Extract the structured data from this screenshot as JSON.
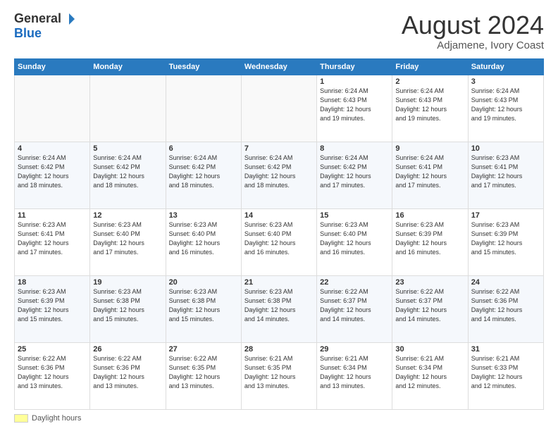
{
  "logo": {
    "general": "General",
    "blue": "Blue"
  },
  "header": {
    "month_year": "August 2024",
    "location": "Adjamene, Ivory Coast"
  },
  "days_of_week": [
    "Sunday",
    "Monday",
    "Tuesday",
    "Wednesday",
    "Thursday",
    "Friday",
    "Saturday"
  ],
  "footer": {
    "swatch_label": "Daylight hours"
  },
  "weeks": [
    [
      {
        "day": "",
        "info": ""
      },
      {
        "day": "",
        "info": ""
      },
      {
        "day": "",
        "info": ""
      },
      {
        "day": "",
        "info": ""
      },
      {
        "day": "1",
        "info": "Sunrise: 6:24 AM\nSunset: 6:43 PM\nDaylight: 12 hours\nand 19 minutes."
      },
      {
        "day": "2",
        "info": "Sunrise: 6:24 AM\nSunset: 6:43 PM\nDaylight: 12 hours\nand 19 minutes."
      },
      {
        "day": "3",
        "info": "Sunrise: 6:24 AM\nSunset: 6:43 PM\nDaylight: 12 hours\nand 19 minutes."
      }
    ],
    [
      {
        "day": "4",
        "info": "Sunrise: 6:24 AM\nSunset: 6:42 PM\nDaylight: 12 hours\nand 18 minutes."
      },
      {
        "day": "5",
        "info": "Sunrise: 6:24 AM\nSunset: 6:42 PM\nDaylight: 12 hours\nand 18 minutes."
      },
      {
        "day": "6",
        "info": "Sunrise: 6:24 AM\nSunset: 6:42 PM\nDaylight: 12 hours\nand 18 minutes."
      },
      {
        "day": "7",
        "info": "Sunrise: 6:24 AM\nSunset: 6:42 PM\nDaylight: 12 hours\nand 18 minutes."
      },
      {
        "day": "8",
        "info": "Sunrise: 6:24 AM\nSunset: 6:42 PM\nDaylight: 12 hours\nand 17 minutes."
      },
      {
        "day": "9",
        "info": "Sunrise: 6:24 AM\nSunset: 6:41 PM\nDaylight: 12 hours\nand 17 minutes."
      },
      {
        "day": "10",
        "info": "Sunrise: 6:23 AM\nSunset: 6:41 PM\nDaylight: 12 hours\nand 17 minutes."
      }
    ],
    [
      {
        "day": "11",
        "info": "Sunrise: 6:23 AM\nSunset: 6:41 PM\nDaylight: 12 hours\nand 17 minutes."
      },
      {
        "day": "12",
        "info": "Sunrise: 6:23 AM\nSunset: 6:40 PM\nDaylight: 12 hours\nand 17 minutes."
      },
      {
        "day": "13",
        "info": "Sunrise: 6:23 AM\nSunset: 6:40 PM\nDaylight: 12 hours\nand 16 minutes."
      },
      {
        "day": "14",
        "info": "Sunrise: 6:23 AM\nSunset: 6:40 PM\nDaylight: 12 hours\nand 16 minutes."
      },
      {
        "day": "15",
        "info": "Sunrise: 6:23 AM\nSunset: 6:40 PM\nDaylight: 12 hours\nand 16 minutes."
      },
      {
        "day": "16",
        "info": "Sunrise: 6:23 AM\nSunset: 6:39 PM\nDaylight: 12 hours\nand 16 minutes."
      },
      {
        "day": "17",
        "info": "Sunrise: 6:23 AM\nSunset: 6:39 PM\nDaylight: 12 hours\nand 15 minutes."
      }
    ],
    [
      {
        "day": "18",
        "info": "Sunrise: 6:23 AM\nSunset: 6:39 PM\nDaylight: 12 hours\nand 15 minutes."
      },
      {
        "day": "19",
        "info": "Sunrise: 6:23 AM\nSunset: 6:38 PM\nDaylight: 12 hours\nand 15 minutes."
      },
      {
        "day": "20",
        "info": "Sunrise: 6:23 AM\nSunset: 6:38 PM\nDaylight: 12 hours\nand 15 minutes."
      },
      {
        "day": "21",
        "info": "Sunrise: 6:23 AM\nSunset: 6:38 PM\nDaylight: 12 hours\nand 14 minutes."
      },
      {
        "day": "22",
        "info": "Sunrise: 6:22 AM\nSunset: 6:37 PM\nDaylight: 12 hours\nand 14 minutes."
      },
      {
        "day": "23",
        "info": "Sunrise: 6:22 AM\nSunset: 6:37 PM\nDaylight: 12 hours\nand 14 minutes."
      },
      {
        "day": "24",
        "info": "Sunrise: 6:22 AM\nSunset: 6:36 PM\nDaylight: 12 hours\nand 14 minutes."
      }
    ],
    [
      {
        "day": "25",
        "info": "Sunrise: 6:22 AM\nSunset: 6:36 PM\nDaylight: 12 hours\nand 13 minutes."
      },
      {
        "day": "26",
        "info": "Sunrise: 6:22 AM\nSunset: 6:36 PM\nDaylight: 12 hours\nand 13 minutes."
      },
      {
        "day": "27",
        "info": "Sunrise: 6:22 AM\nSunset: 6:35 PM\nDaylight: 12 hours\nand 13 minutes."
      },
      {
        "day": "28",
        "info": "Sunrise: 6:21 AM\nSunset: 6:35 PM\nDaylight: 12 hours\nand 13 minutes."
      },
      {
        "day": "29",
        "info": "Sunrise: 6:21 AM\nSunset: 6:34 PM\nDaylight: 12 hours\nand 13 minutes."
      },
      {
        "day": "30",
        "info": "Sunrise: 6:21 AM\nSunset: 6:34 PM\nDaylight: 12 hours\nand 12 minutes."
      },
      {
        "day": "31",
        "info": "Sunrise: 6:21 AM\nSunset: 6:33 PM\nDaylight: 12 hours\nand 12 minutes."
      }
    ]
  ]
}
